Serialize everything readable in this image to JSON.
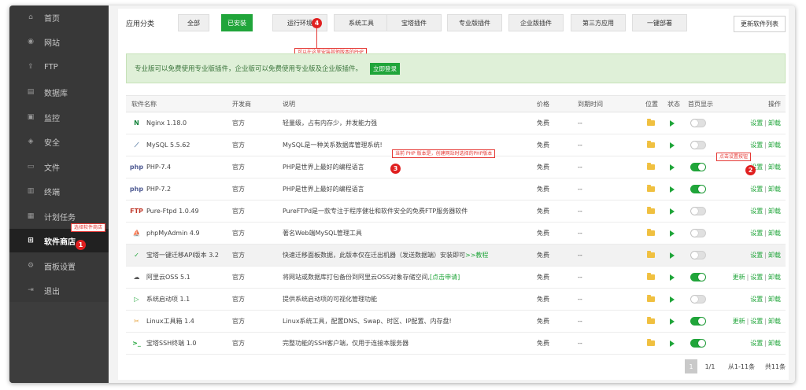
{
  "sidebar": {
    "items": [
      {
        "label": "首页",
        "icon": "home-icon",
        "glyph": "⌂"
      },
      {
        "label": "网站",
        "icon": "globe-icon",
        "glyph": "◉"
      },
      {
        "label": "FTP",
        "icon": "ftp-icon",
        "glyph": "⇪"
      },
      {
        "label": "数据库",
        "icon": "database-icon",
        "glyph": "▤"
      },
      {
        "label": "监控",
        "icon": "monitor-icon",
        "glyph": "▣"
      },
      {
        "label": "安全",
        "icon": "shield-icon",
        "glyph": "◈"
      },
      {
        "label": "文件",
        "icon": "folder-icon",
        "glyph": "▭"
      },
      {
        "label": "终端",
        "icon": "terminal-icon",
        "glyph": "▥"
      },
      {
        "label": "计划任务",
        "icon": "calendar-icon",
        "glyph": "▦"
      },
      {
        "label": "软件商店",
        "icon": "grid-icon",
        "glyph": "⊞"
      },
      {
        "label": "面板设置",
        "icon": "gear-icon",
        "glyph": "⚙"
      },
      {
        "label": "退出",
        "icon": "logout-icon",
        "glyph": "⇥"
      }
    ],
    "active_index": 9
  },
  "categories": {
    "label": "应用分类",
    "tabs": [
      "全部",
      "已安装",
      "运行环境",
      "系统工具",
      "宝塔插件",
      "专业版插件",
      "企业版插件",
      "第三方应用",
      "一键部署"
    ],
    "active_index": 1,
    "refresh_button": "更新软件列表"
  },
  "banner": {
    "text": "专业版可以免费使用专业版插件，企业版可以免费使用专业版及企业版插件。",
    "login_button": "立即登录"
  },
  "annotations": {
    "a1": {
      "badge": "1",
      "text": "选择软件商店"
    },
    "a2": {
      "badge": "2",
      "text": "点击设置按钮"
    },
    "a3": {
      "badge": "3",
      "text": "当前 PHP 版本是，创建网站时选择的PHP版本"
    },
    "a4": {
      "badge": "4",
      "text": "可以在这里安装其他版本的PHP"
    }
  },
  "table": {
    "headers": {
      "name": "软件名称",
      "developer": "开发商",
      "description": "说明",
      "price": "价格",
      "expiry": "到期时间",
      "location": "位置",
      "status": "状态",
      "homepage": "首页显示",
      "actions": "操作"
    },
    "rows": [
      {
        "icon_text": "N",
        "icon_color": "#14833b",
        "name": "Nginx 1.18.0",
        "developer": "官方",
        "description": "轻量级，占有内存少，并发能力强",
        "link": "",
        "price": "免费",
        "expiry": "--",
        "homepage_on": false,
        "update": "",
        "settings": "设置",
        "uninstall": "卸载"
      },
      {
        "icon_text": "⟋",
        "icon_color": "#5b7fa6",
        "name": "MySQL 5.5.62",
        "developer": "官方",
        "description": "MySQL是一种关系数据库管理系统!",
        "link": "",
        "price": "免费",
        "expiry": "--",
        "homepage_on": false,
        "update": "",
        "settings": "设置",
        "uninstall": "卸载"
      },
      {
        "icon_text": "php",
        "icon_color": "#4f5b93",
        "name": "PHP-7.4",
        "developer": "官方",
        "description": "PHP是世界上最好的编程语言",
        "link": "",
        "price": "免费",
        "expiry": "--",
        "homepage_on": true,
        "update": "",
        "settings": "设置",
        "uninstall": "卸载"
      },
      {
        "icon_text": "php",
        "icon_color": "#4f5b93",
        "name": "PHP-7.2",
        "developer": "官方",
        "description": "PHP是世界上最好的编程语言",
        "link": "",
        "price": "免费",
        "expiry": "--",
        "homepage_on": true,
        "update": "",
        "settings": "设置",
        "uninstall": "卸载"
      },
      {
        "icon_text": "FTP",
        "icon_color": "#c0392b",
        "name": "Pure-Ftpd 1.0.49",
        "developer": "官方",
        "description": "PureFTPd是一款专注于程序健壮和软件安全的免费FTP服务器软件",
        "link": "",
        "price": "免费",
        "expiry": "--",
        "homepage_on": false,
        "update": "",
        "settings": "设置",
        "uninstall": "卸载"
      },
      {
        "icon_text": "⛵",
        "icon_color": "#e67e22",
        "name": "phpMyAdmin 4.9",
        "developer": "官方",
        "description": "著名Web端MySQL管理工具",
        "link": "",
        "price": "免费",
        "expiry": "--",
        "homepage_on": false,
        "update": "",
        "settings": "设置",
        "uninstall": "卸载"
      },
      {
        "icon_text": "✓",
        "icon_color": "#20a53a",
        "name": "宝塔一键迁移API版本 3.2",
        "developer": "官方",
        "description": "快速迁移面板数据，此版本仅在迁出机器（发送数据端）安装即可",
        "link": ">>教程",
        "price": "免费",
        "expiry": "--",
        "homepage_on": false,
        "update": "",
        "settings": "设置",
        "uninstall": "卸载"
      },
      {
        "icon_text": "☁",
        "icon_color": "#555555",
        "name": "阿里云OSS 5.1",
        "developer": "官方",
        "description": "将网站或数据库打包备份到阿里云OSS对象存储空间,",
        "link": "[点击申请]",
        "price": "免费",
        "expiry": "--",
        "homepage_on": true,
        "update": "更新",
        "settings": "设置",
        "uninstall": "卸载"
      },
      {
        "icon_text": "▷",
        "icon_color": "#20a53a",
        "name": "系统启动项 1.1",
        "developer": "官方",
        "description": "提供系统启动项的可视化管理功能",
        "link": "",
        "price": "免费",
        "expiry": "--",
        "homepage_on": false,
        "update": "",
        "settings": "设置",
        "uninstall": "卸载"
      },
      {
        "icon_text": "✂",
        "icon_color": "#e6a23c",
        "name": "Linux工具箱 1.4",
        "developer": "官方",
        "description": "Linux系统工具，配置DNS、Swap、时区、IP配置、内存盘!",
        "link": "",
        "price": "免费",
        "expiry": "--",
        "homepage_on": true,
        "update": "更新",
        "settings": "设置",
        "uninstall": "卸载"
      },
      {
        "icon_text": ">_",
        "icon_color": "#20a53a",
        "name": "宝塔SSH终端 1.0",
        "developer": "官方",
        "description": "完整功能的SSH客户端，仅用于连接本服务器",
        "link": "",
        "price": "免费",
        "expiry": "--",
        "homepage_on": true,
        "update": "",
        "settings": "设置",
        "uninstall": "卸载"
      }
    ],
    "highlight_row": 6
  },
  "pagination": {
    "current": "1",
    "pages": "1/1",
    "range": "从1-11条",
    "total": "共11条"
  },
  "colors": {
    "accent": "#20a53a",
    "sidebar_bg": "#383838",
    "annotation_red": "#e02020"
  }
}
